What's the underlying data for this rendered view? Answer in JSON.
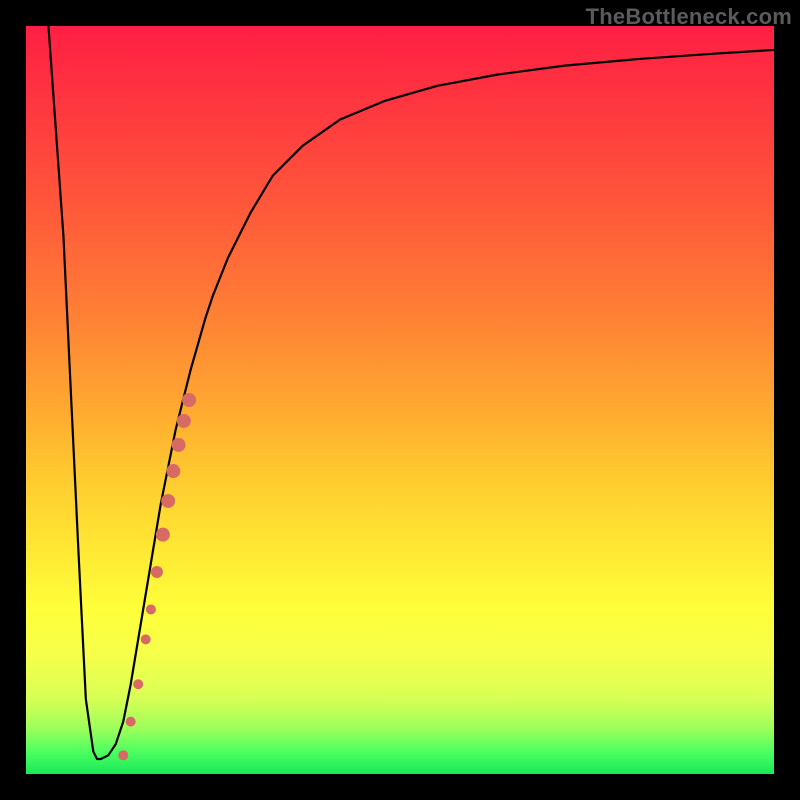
{
  "watermark": "TheBottleneck.com",
  "chart_data": {
    "type": "line",
    "title": "",
    "xlabel": "",
    "ylabel": "",
    "xlim": [
      0,
      100
    ],
    "ylim": [
      0,
      100
    ],
    "grid": false,
    "legend": false,
    "series": [
      {
        "name": "curve",
        "color": "#000000",
        "x": [
          3,
          5,
          7,
          8,
          9,
          9.5,
          10,
          11,
          12,
          13,
          14,
          15,
          16,
          17,
          18,
          19,
          20,
          21,
          22,
          23,
          24,
          25,
          27,
          30,
          33,
          37,
          42,
          48,
          55,
          63,
          72,
          82,
          92,
          100
        ],
        "y": [
          100,
          72,
          30,
          10,
          3,
          2,
          2,
          2.5,
          4,
          7,
          12,
          18,
          24,
          30,
          36,
          41,
          46,
          50,
          54,
          57.5,
          61,
          64,
          69,
          75,
          80,
          84,
          87.5,
          90,
          92,
          93.5,
          94.7,
          95.6,
          96.3,
          96.8
        ]
      }
    ],
    "markers": {
      "name": "markers",
      "color": "#d76a63",
      "points": [
        {
          "x": 13.0,
          "y": 2.5,
          "r": 5
        },
        {
          "x": 14.0,
          "y": 7.0,
          "r": 5
        },
        {
          "x": 15.0,
          "y": 12.0,
          "r": 5
        },
        {
          "x": 16.0,
          "y": 18.0,
          "r": 5
        },
        {
          "x": 16.7,
          "y": 22.0,
          "r": 5
        },
        {
          "x": 17.5,
          "y": 27.0,
          "r": 6
        },
        {
          "x": 18.3,
          "y": 32.0,
          "r": 7
        },
        {
          "x": 19.0,
          "y": 36.5,
          "r": 7
        },
        {
          "x": 19.7,
          "y": 40.5,
          "r": 7
        },
        {
          "x": 20.4,
          "y": 44.0,
          "r": 7
        },
        {
          "x": 21.1,
          "y": 47.2,
          "r": 7
        },
        {
          "x": 21.8,
          "y": 50.0,
          "r": 7
        }
      ]
    }
  }
}
